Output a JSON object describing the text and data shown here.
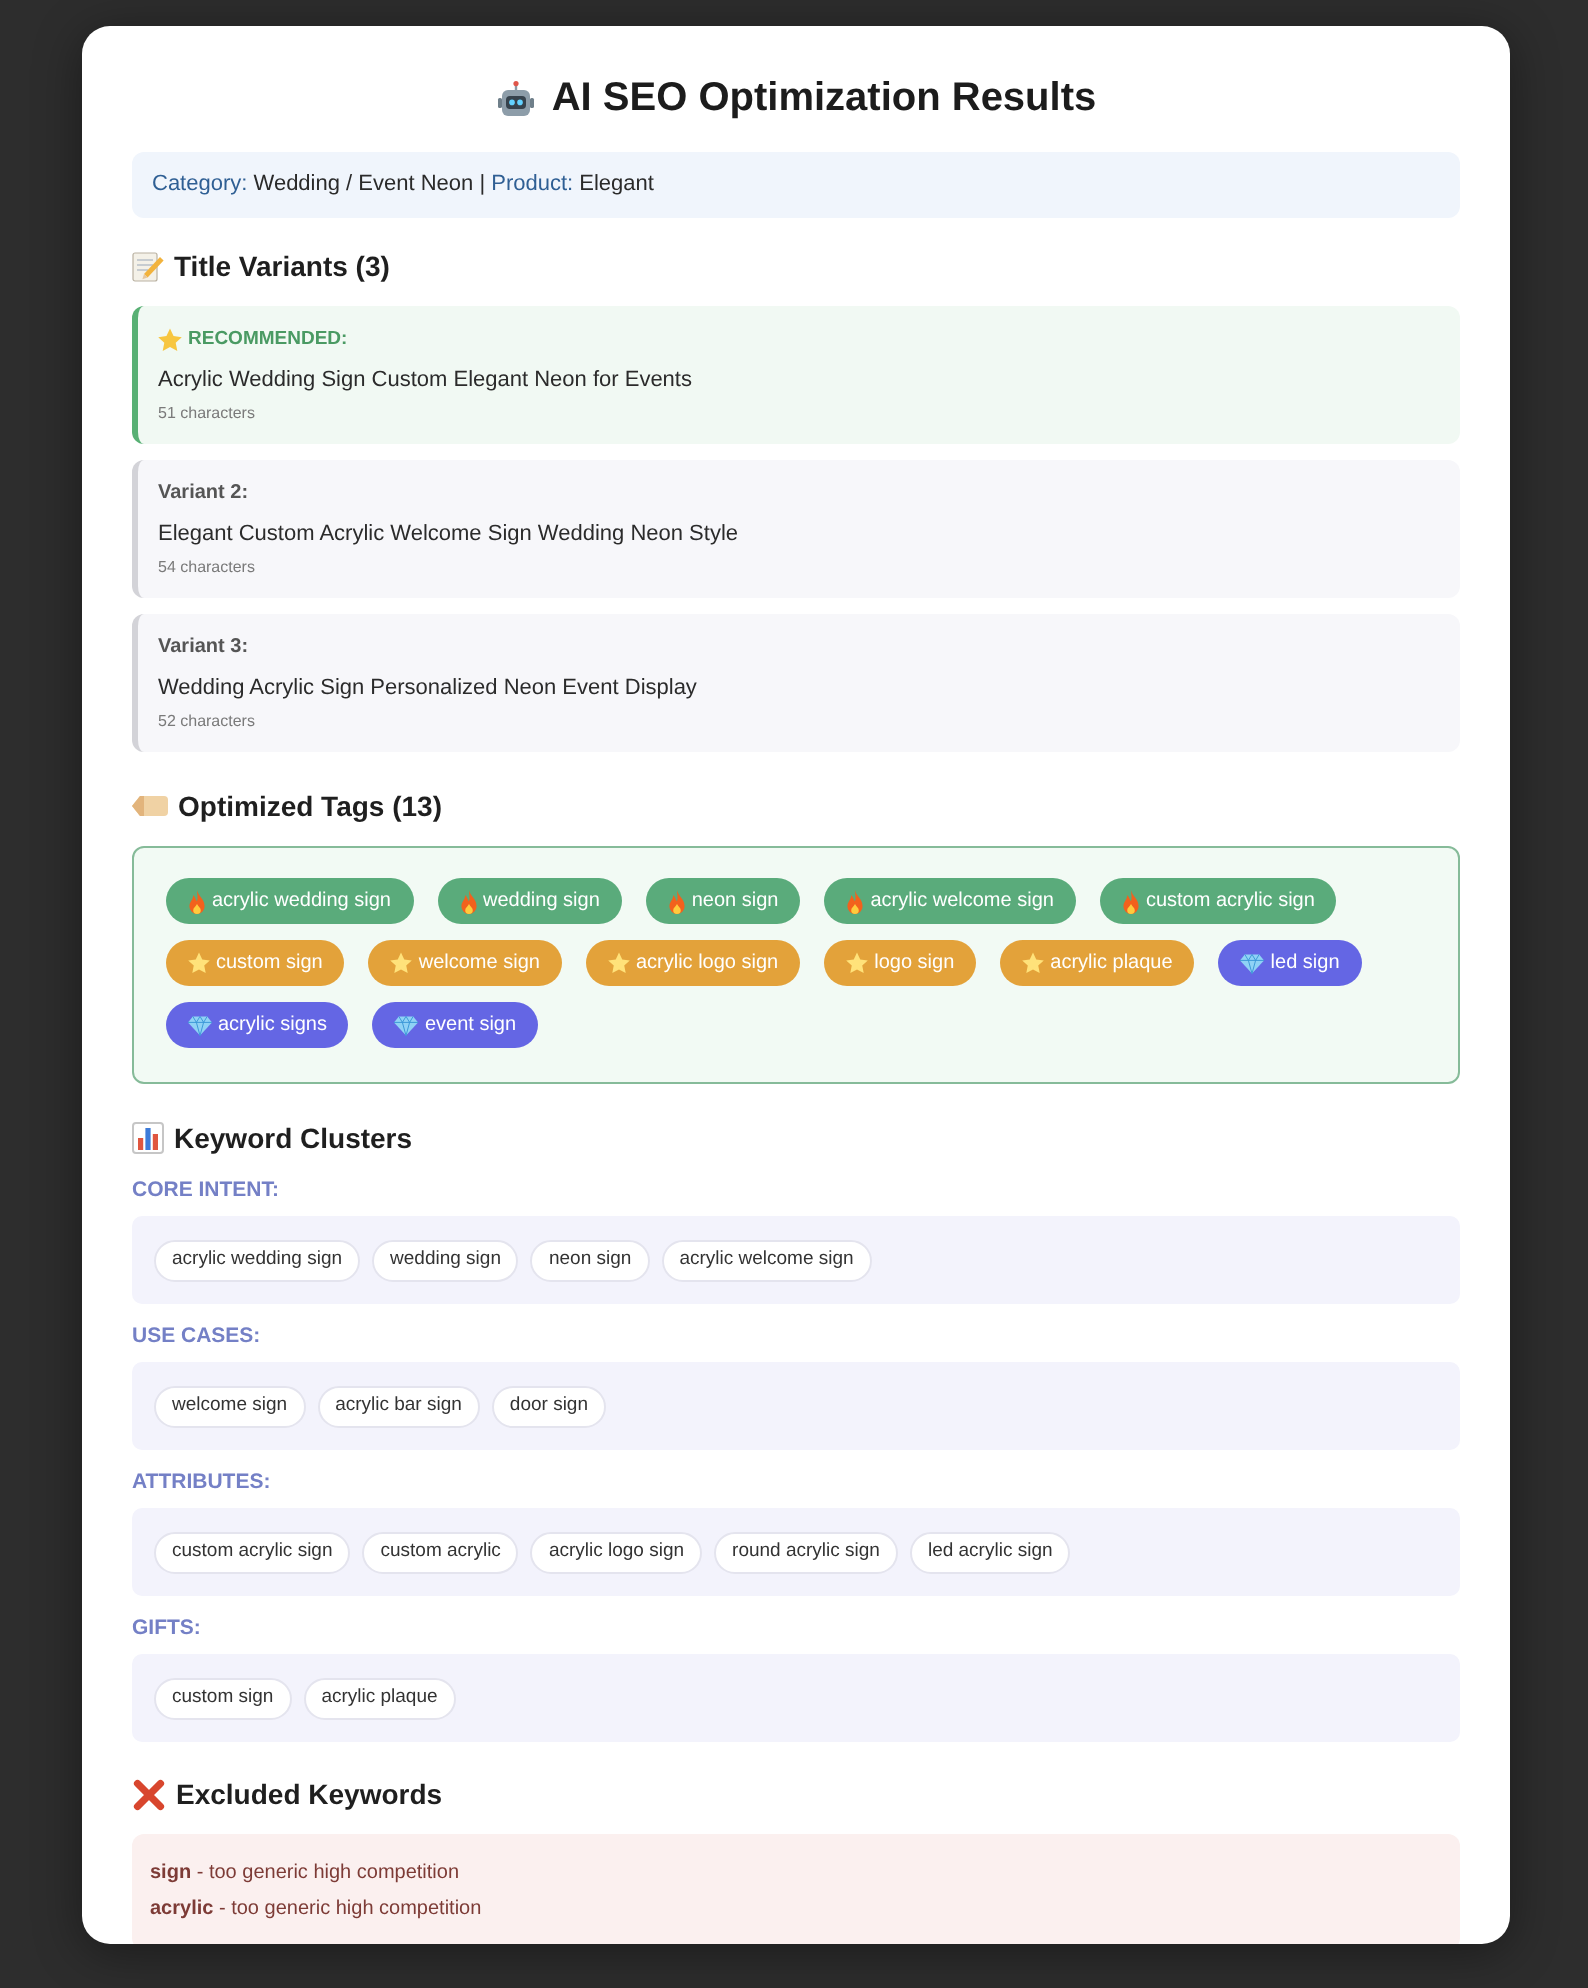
{
  "dialog": {
    "title": "AI SEO Optimization Results"
  },
  "summary": {
    "separator": "|",
    "items": [
      {
        "label": "Category:",
        "value": "Wedding / Event Neon"
      },
      {
        "label": "Product:",
        "value": "Elegant"
      }
    ]
  },
  "title_variants": {
    "heading": "Title Variants (3)",
    "items": [
      {
        "kind": "recommended",
        "label": "RECOMMENDED:",
        "title": "Acrylic Wedding Sign Custom Elegant Neon for Events",
        "count": "51 characters"
      },
      {
        "kind": "variant",
        "label": "Variant 2:",
        "title": "Elegant Custom Acrylic Welcome Sign Wedding Neon Style",
        "count": "54 characters"
      },
      {
        "kind": "variant",
        "label": "Variant 3:",
        "title": "Wedding Acrylic Sign Personalized Neon Event Display",
        "count": "52 characters"
      }
    ]
  },
  "optimized_tags": {
    "heading": "Optimized Tags (13)",
    "tags": [
      {
        "kind": "fire",
        "color": "#5aab7b",
        "label": "acrylic wedding sign"
      },
      {
        "kind": "fire",
        "color": "#5aab7b",
        "label": "wedding sign"
      },
      {
        "kind": "fire",
        "color": "#5aab7b",
        "label": "neon sign"
      },
      {
        "kind": "fire",
        "color": "#5aab7b",
        "label": "acrylic welcome sign"
      },
      {
        "kind": "fire",
        "color": "#5aab7b",
        "label": "custom acrylic sign"
      },
      {
        "kind": "star",
        "color": "#e3a23a",
        "label": "custom sign"
      },
      {
        "kind": "star",
        "color": "#e3a23a",
        "label": "welcome sign"
      },
      {
        "kind": "star",
        "color": "#e3a23a",
        "label": "acrylic logo sign"
      },
      {
        "kind": "star",
        "color": "#e3a23a",
        "label": "logo sign"
      },
      {
        "kind": "star",
        "color": "#e3a23a",
        "label": "acrylic plaque"
      },
      {
        "kind": "gem",
        "color": "#6466e4",
        "label": "led sign"
      },
      {
        "kind": "gem",
        "color": "#6466e4",
        "label": "acrylic signs"
      },
      {
        "kind": "gem",
        "color": "#6466e4",
        "label": "event sign"
      }
    ]
  },
  "keyword_clusters": {
    "heading": "Keyword Clusters",
    "clusters": [
      {
        "label": "CORE INTENT:",
        "keywords": [
          "acrylic wedding sign",
          "wedding sign",
          "neon sign",
          "acrylic welcome sign"
        ]
      },
      {
        "label": "USE CASES:",
        "keywords": [
          "welcome sign",
          "acrylic bar sign",
          "door sign"
        ]
      },
      {
        "label": "ATTRIBUTES:",
        "keywords": [
          "custom acrylic sign",
          "custom acrylic",
          "acrylic logo sign",
          "round acrylic sign",
          "led acrylic sign"
        ]
      },
      {
        "label": "GIFTS:",
        "keywords": [
          "custom sign",
          "acrylic plaque"
        ]
      }
    ]
  },
  "excluded_keywords": {
    "heading": "Excluded Keywords",
    "items": [
      "**sign** - too generic high competition",
      "**acrylic** - too generic high competition"
    ]
  }
}
